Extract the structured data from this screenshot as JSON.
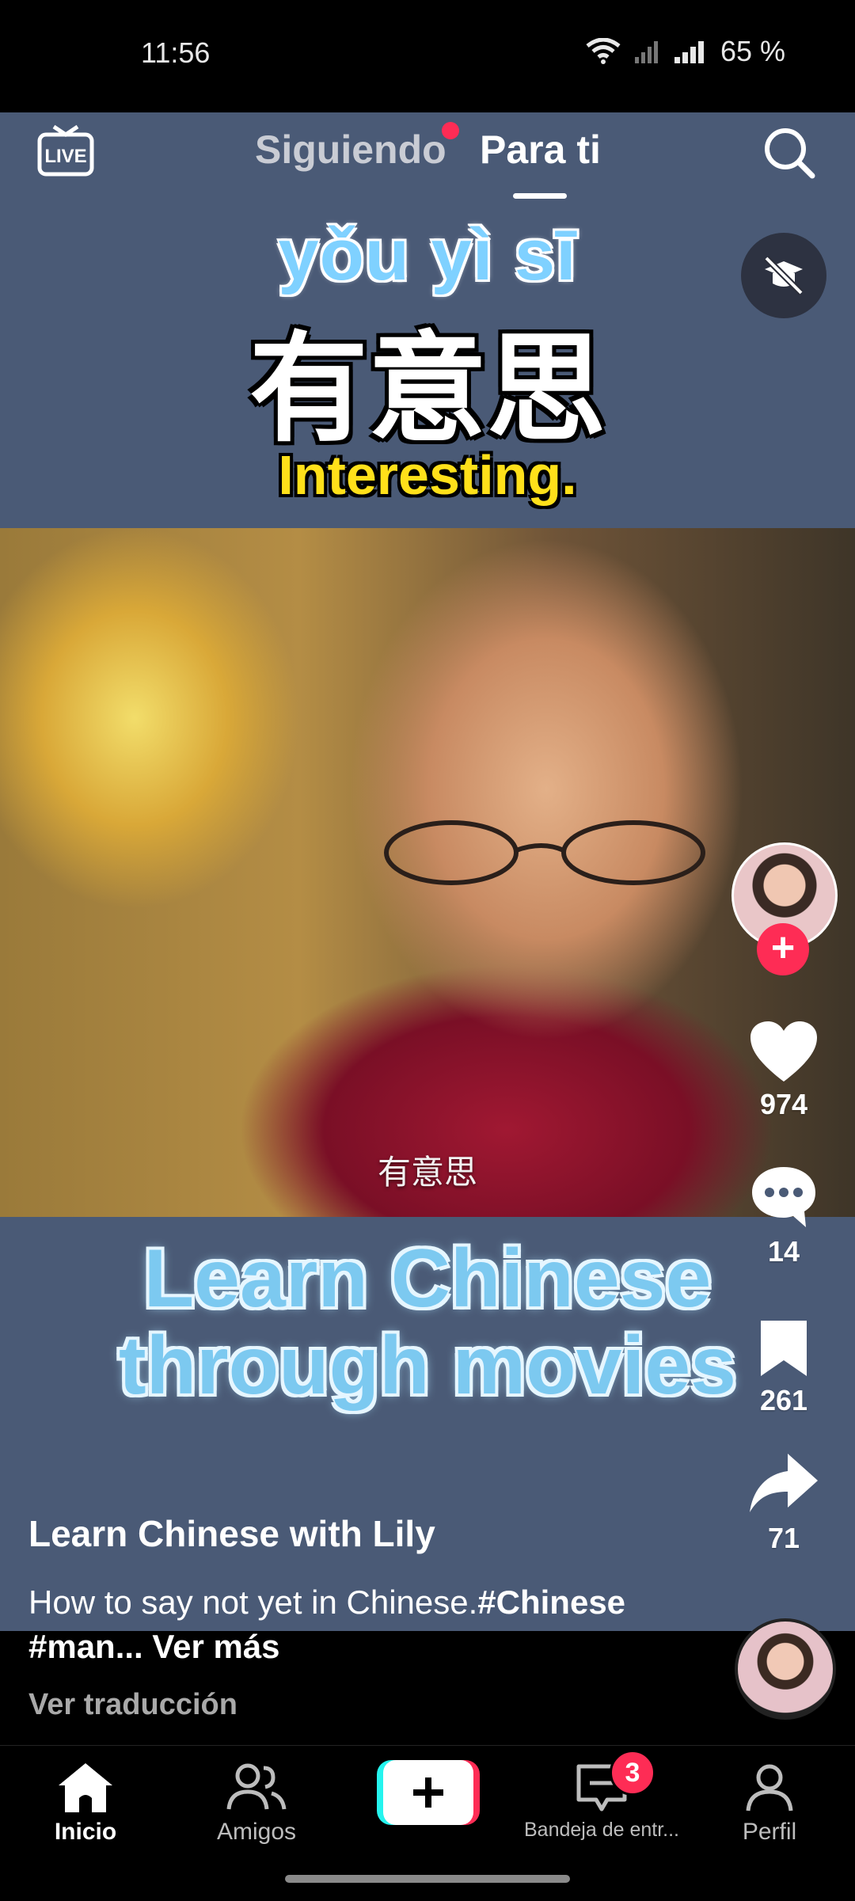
{
  "status_bar": {
    "time": "11:56",
    "battery": "65 %"
  },
  "top_nav": {
    "following": "Siguiendo",
    "for_you": "Para ti"
  },
  "video": {
    "pinyin": "yǒu yì sī",
    "hanzi": "有意思",
    "meaning": "Interesting.",
    "subtitle": "有意思",
    "promo_line1": "Learn Chinese",
    "promo_line2": "through movies"
  },
  "actions": {
    "likes": "974",
    "comments": "14",
    "saves": "261",
    "shares": "71"
  },
  "post": {
    "author": "Learn Chinese with Lily",
    "caption_text": "How to say not yet in Chinese.",
    "caption_tags": "#Chinese #man...",
    "see_more": "Ver más",
    "translate": "Ver traducción"
  },
  "bottom_nav": {
    "home": "Inicio",
    "friends": "Amigos",
    "inbox": "Bandeja de entr...",
    "inbox_badge": "3",
    "profile": "Perfil"
  },
  "colors": {
    "accent": "#fe2c55",
    "background": "#4a5a76"
  }
}
